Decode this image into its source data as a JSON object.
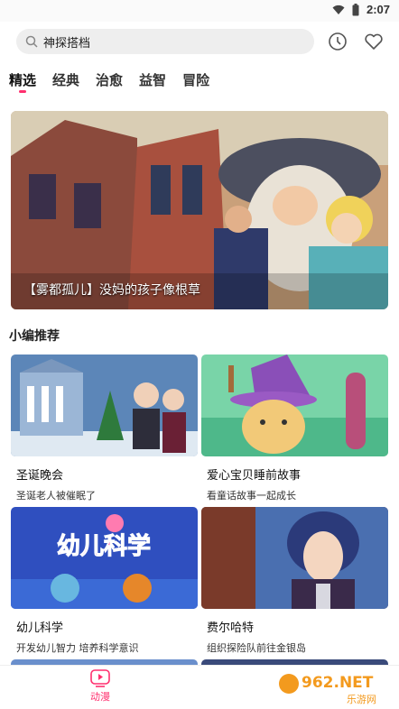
{
  "status_bar": {
    "time": "2:07"
  },
  "search": {
    "value": "神探搭档"
  },
  "header_icons": [
    "history-icon",
    "favorites-heart-icon"
  ],
  "tabs": [
    {
      "label": "精选",
      "active": true
    },
    {
      "label": "经典",
      "active": false
    },
    {
      "label": "治愈",
      "active": false
    },
    {
      "label": "益智",
      "active": false
    },
    {
      "label": "冒险",
      "active": false
    }
  ],
  "banner": {
    "caption": "【雾都孤儿】没妈的孩子像根草"
  },
  "section": {
    "title": "小编推荐"
  },
  "cards": [
    {
      "title": "圣诞晚会",
      "subtitle": "圣诞老人被催眠了"
    },
    {
      "title": "爱心宝贝睡前故事",
      "subtitle": "看童话故事一起成长"
    },
    {
      "title": "幼儿科学",
      "subtitle": "开发幼儿智力 培养科学意识",
      "thumb_text": "幼儿科学"
    },
    {
      "title": "费尔哈特",
      "subtitle": "组织探险队前往金银岛"
    }
  ],
  "bottom_nav": {
    "label": "动漫"
  },
  "watermark": {
    "text": "962.NET",
    "subtext": "乐游网"
  },
  "colors": {
    "accent": "#ff2f6e",
    "search_bg": "#eeeeee"
  }
}
